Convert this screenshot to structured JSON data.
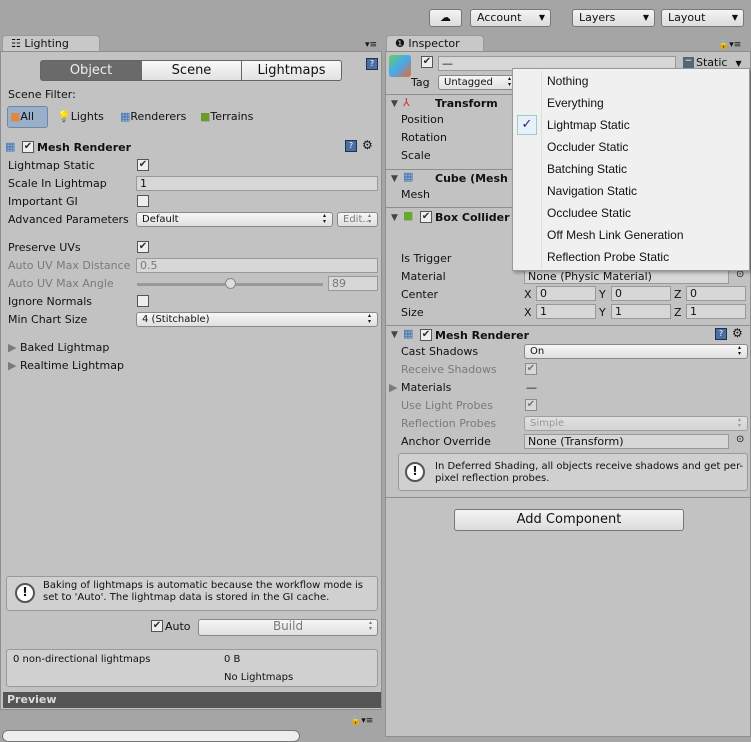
{
  "toolbar": {
    "cloud_icon": "cloud-icon",
    "account": "Account",
    "layers": "Layers",
    "layout": "Layout"
  },
  "lighting": {
    "tab": "Lighting",
    "modes": [
      "Object",
      "Scene",
      "Lightmaps"
    ],
    "active_mode": "Object",
    "scene_filter_label": "Scene Filter:",
    "filters": [
      "All",
      "Lights",
      "Renderers",
      "Terrains"
    ],
    "component": "Mesh Renderer",
    "fields": {
      "lightmap_static": "Lightmap Static",
      "scale_in_lightmap": "Scale In Lightmap",
      "scale_value": "1",
      "important_gi": "Important GI",
      "advanced_parameters": "Advanced Parameters",
      "advanced_value": "Default",
      "edit": "Edit...",
      "preserve_uvs": "Preserve UVs",
      "auto_uv_max_distance": "Auto UV Max Distance",
      "auto_uv_max_distance_value": "0.5",
      "auto_uv_max_angle": "Auto UV Max Angle",
      "auto_uv_max_angle_value": "89",
      "ignore_normals": "Ignore Normals",
      "min_chart_size": "Min Chart Size",
      "min_chart_size_value": "4 (Stitchable)"
    },
    "checks": {
      "lightmap_static": true,
      "important_gi": false,
      "preserve_uvs": true,
      "ignore_normals": false,
      "auto": true
    },
    "baked_lightmap": "Baked Lightmap",
    "realtime_lightmap": "Realtime Lightmap",
    "help": "Baking of lightmaps is automatic because the workflow mode is set to 'Auto'. The lightmap data is stored in the GI cache.",
    "auto": "Auto",
    "build": "Build",
    "stats": {
      "count": "0 non-directional lightmaps",
      "size": "0 B",
      "status": "No Lightmaps"
    },
    "preview": "Preview"
  },
  "inspector": {
    "tab": "Inspector",
    "name_value": "—",
    "static": "Static",
    "tag_label": "Tag",
    "tag_value": "Untagged",
    "transform": {
      "title": "Transform",
      "position": "Position",
      "rotation": "Rotation",
      "scale": "Scale"
    },
    "mesh_filter": {
      "title": "Cube (Mesh",
      "mesh": "Mesh"
    },
    "box_collider": {
      "title": "Box Collider",
      "is_trigger": "Is Trigger",
      "material": "Material",
      "material_value": "None (Physic Material)",
      "center": "Center",
      "size": "Size",
      "center_values": [
        "0",
        "0",
        "0"
      ],
      "size_values": [
        "1",
        "1",
        "1"
      ],
      "axes": [
        "X",
        "Y",
        "Z"
      ]
    },
    "mesh_renderer": {
      "title": "Mesh Renderer",
      "cast_shadows": "Cast Shadows",
      "cast_shadows_value": "On",
      "receive_shadows": "Receive Shadows",
      "materials": "Materials",
      "materials_value": "—",
      "use_light_probes": "Use Light Probes",
      "reflection_probes": "Reflection Probes",
      "reflection_probes_value": "Simple",
      "anchor_override": "Anchor Override",
      "anchor_value": "None (Transform)",
      "help": "In Deferred Shading, all objects receive shadows and get per-pixel reflection probes."
    },
    "add_component": "Add Component"
  },
  "static_menu": {
    "items": [
      "Nothing",
      "Everything",
      "Lightmap Static",
      "Occluder Static",
      "Batching Static",
      "Navigation Static",
      "Occludee Static",
      "Off Mesh Link Generation",
      "Reflection Probe Static"
    ],
    "checked": "Lightmap Static"
  }
}
